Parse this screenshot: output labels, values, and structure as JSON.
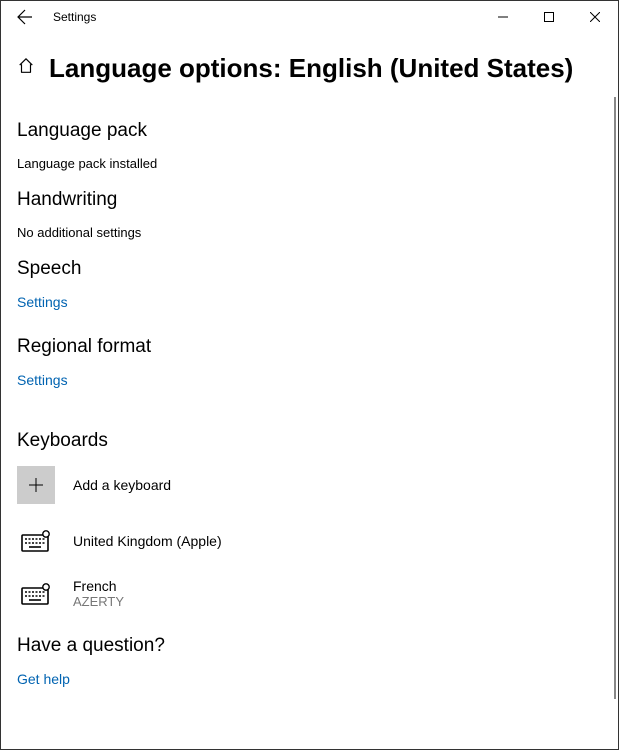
{
  "titlebar": {
    "title": "Settings"
  },
  "header": {
    "title": "Language options: English (United States)"
  },
  "sections": {
    "language_pack": {
      "heading": "Language pack",
      "status": "Language pack installed"
    },
    "handwriting": {
      "heading": "Handwriting",
      "status": "No additional settings"
    },
    "speech": {
      "heading": "Speech",
      "link": "Settings"
    },
    "regional": {
      "heading": "Regional format",
      "link": "Settings"
    },
    "keyboards": {
      "heading": "Keyboards",
      "add_label": "Add a keyboard",
      "items": [
        {
          "name": "United Kingdom (Apple)",
          "sub": ""
        },
        {
          "name": "French",
          "sub": "AZERTY"
        }
      ]
    },
    "help": {
      "heading": "Have a question?",
      "link": "Get help"
    }
  }
}
